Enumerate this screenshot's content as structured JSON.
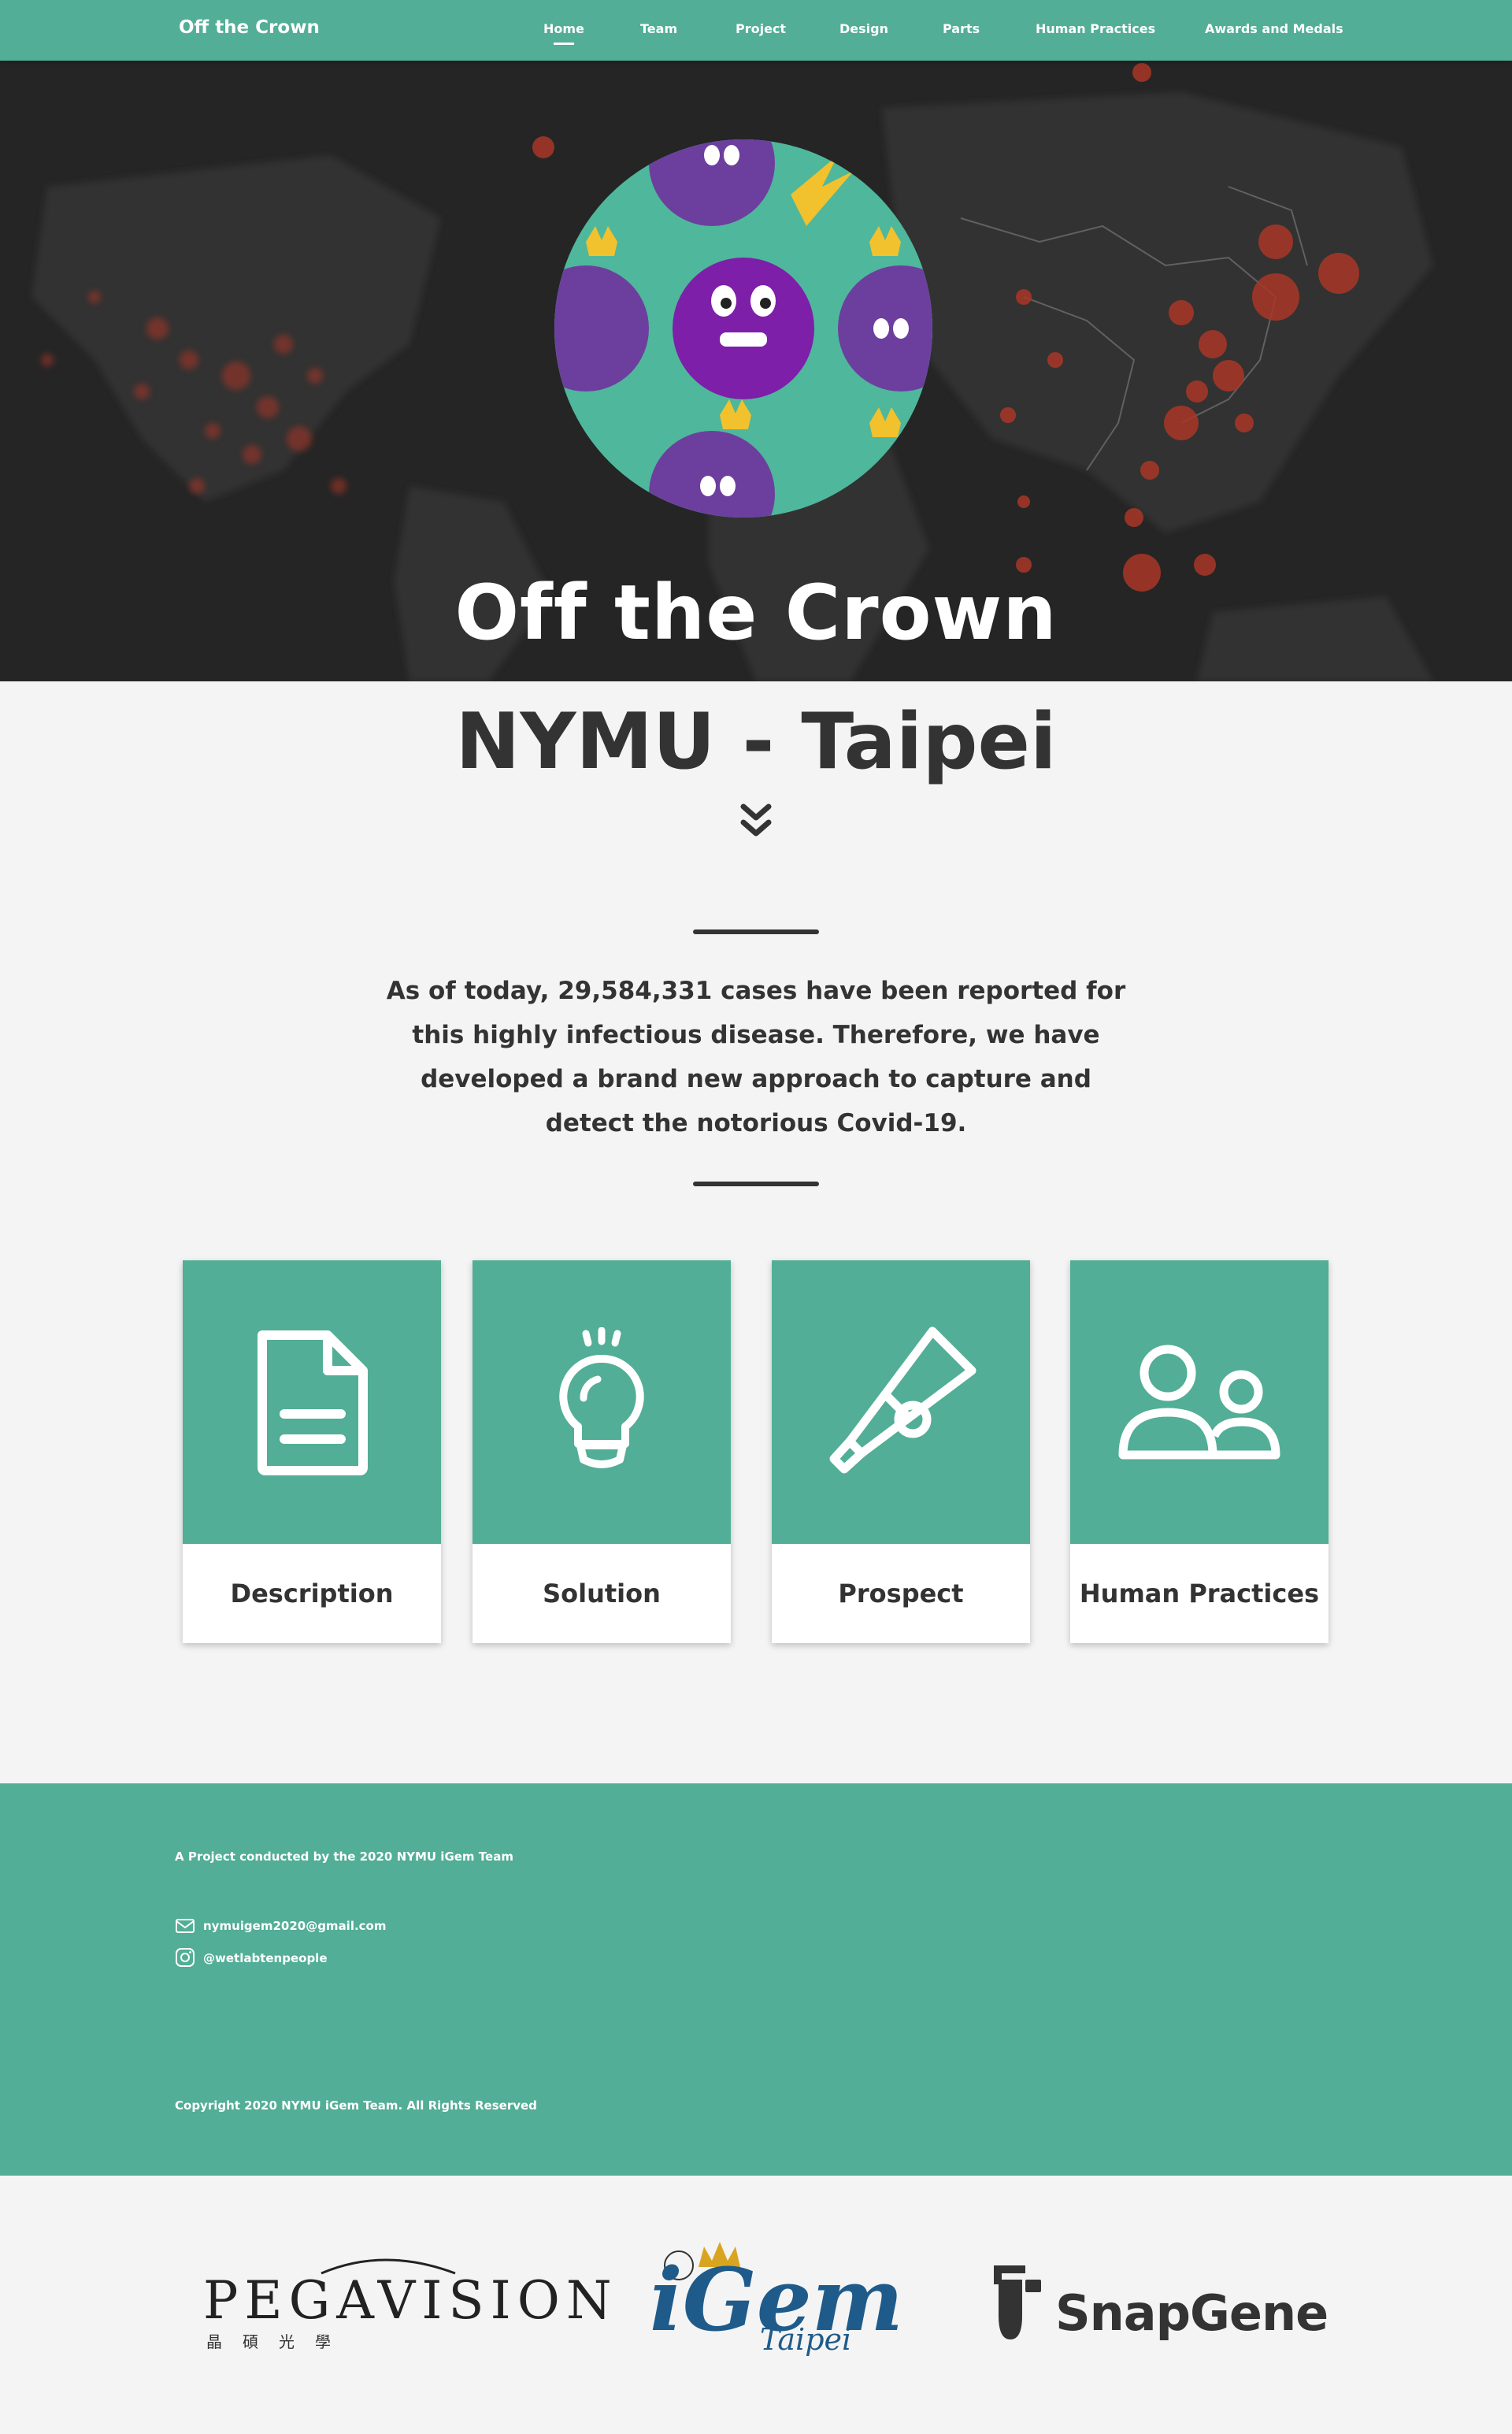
{
  "nav": {
    "brand": "Off the Crown",
    "items": [
      {
        "label": "Home",
        "active": true
      },
      {
        "label": "Team"
      },
      {
        "label": "Project"
      },
      {
        "label": "Design"
      },
      {
        "label": "Parts"
      },
      {
        "label": "Human Practices"
      },
      {
        "label": "Awards and Medals"
      }
    ]
  },
  "hero": {
    "title": "Off the Crown"
  },
  "subtitle": "NYMU - Taipei",
  "intro": "As of today, 29,584,331 cases have been reported for this highly infectious  disease. Therefore, we have developed a brand new approach to capture and detect the notorious Covid-19.",
  "cards": [
    {
      "label": "Description",
      "icon": "document-icon"
    },
    {
      "label": "Solution",
      "icon": "lightbulb-icon"
    },
    {
      "label": "Prospect",
      "icon": "telescope-icon"
    },
    {
      "label": "Human Practices",
      "icon": "people-icon"
    }
  ],
  "footer": {
    "tagline": "A Project conducted by the 2020 NYMU iGem Team",
    "email": "nymuigem2020@gmail.com",
    "instagram": "@wetlabtenpeople",
    "copyright": "Copyright 2020 NYMU iGem Team. All Rights Reserved"
  },
  "sponsors": {
    "pegavision": "PEGAVISION",
    "pegavision_sub": "晶碩光學",
    "igem": "iGem",
    "igem_sub": "Taipei",
    "snapgene": "SnapGene"
  },
  "colors": {
    "accent": "#52ae96",
    "text": "#333333",
    "background": "#f4f4f4"
  }
}
